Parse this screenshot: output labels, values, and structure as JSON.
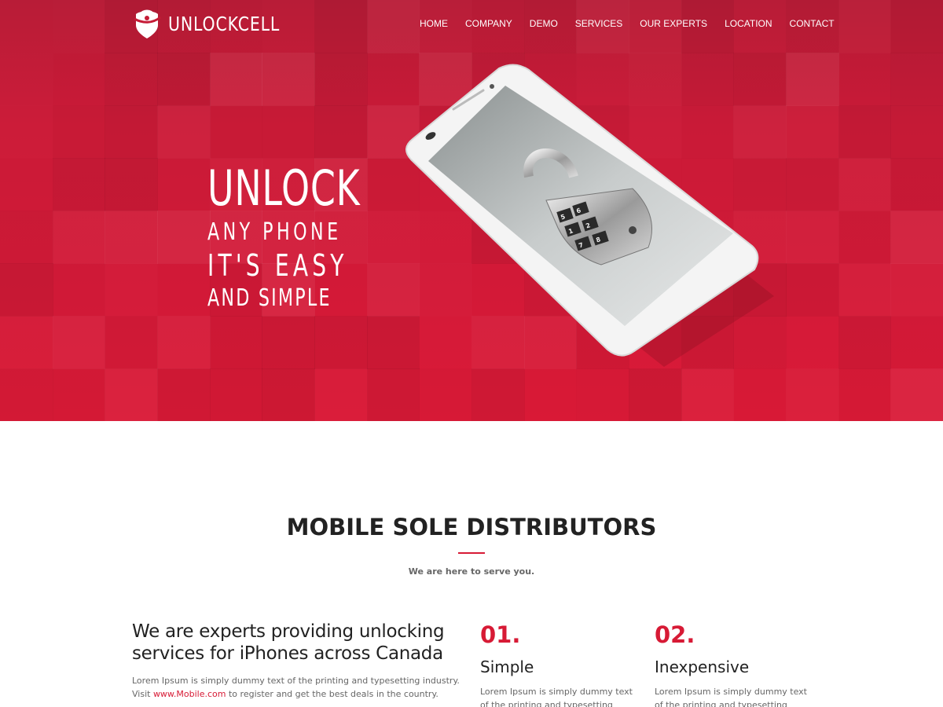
{
  "brand": {
    "name": "UNLOCKCELL",
    "accent_color": "#d71a35",
    "logo_icon": "shield-lock-icon"
  },
  "nav": {
    "items": [
      "HOME",
      "COMPANY",
      "DEMO",
      "SERVICES",
      "OUR EXPERTS",
      "LOCATION",
      "CONTACT"
    ]
  },
  "hero": {
    "line1": "UNLOCK",
    "line2": "ANY PHONE",
    "line3": "IT'S EASY",
    "line4": "AND SIMPLE",
    "image": "phone-with-padlock"
  },
  "section": {
    "title": "MOBILE SOLE DISTRIBUTORS",
    "subtitle": "We are here to serve you."
  },
  "intro": {
    "heading": "We are experts providing unlocking services for iPhones across Canada",
    "body_start": "Lorem Ipsum is simply dummy text of the printing and typesetting industry. Visit ",
    "link": "www.Mobile.com",
    "body_end": " to register and get the best deals in the country."
  },
  "features": [
    {
      "number": "01.",
      "title": "Simple",
      "body": "Lorem Ipsum is simply dummy text of the printing and typesetting industry."
    },
    {
      "number": "02.",
      "title": "Inexpensive",
      "body": "Lorem Ipsum is simply dummy text of the printing and typesetting industry."
    }
  ]
}
